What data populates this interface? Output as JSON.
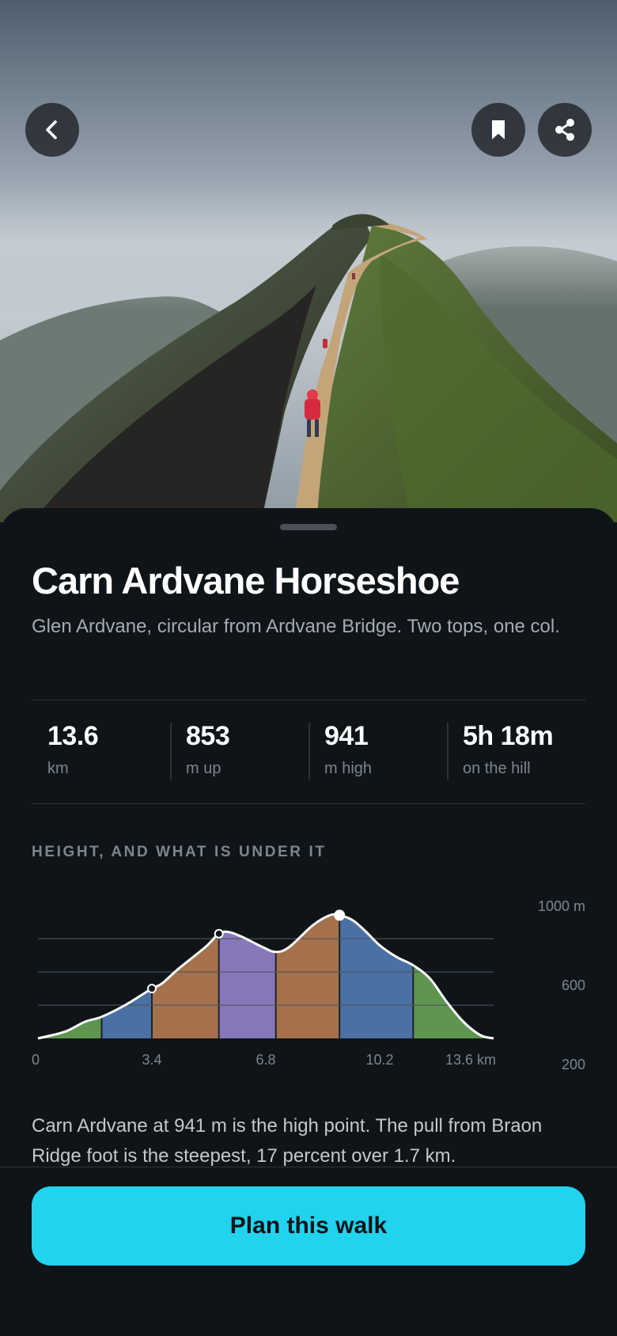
{
  "colors": {
    "accent": "#22d3ee",
    "background": "#0f1418",
    "terrain_green": "#5e9650",
    "terrain_blue": "#4b70a4",
    "terrain_brown": "#a4714c",
    "terrain_purple": "#8678b8"
  },
  "header": {
    "back_icon": "chevron-left-icon",
    "bookmark_icon": "bookmark-icon",
    "share_icon": "share-icon"
  },
  "route": {
    "title": "Carn Ardvane Horseshoe",
    "subtitle": "Glen Ardvane, circular from Ardvane Bridge. Two tops, one col."
  },
  "stats": [
    {
      "value": "13.6",
      "label": "km"
    },
    {
      "value": "853",
      "label": "m up"
    },
    {
      "value": "941",
      "label": "m high"
    },
    {
      "value": "5h 18m",
      "label": "on the hill"
    }
  ],
  "profile": {
    "section_label": "HEIGHT, AND WHAT IS UNDER IT",
    "note": "Carn Ardvane at 941 m is the high point. The pull from Braon Ridge foot is the steepest, 17 percent over 1.7 km."
  },
  "chart_data": {
    "type": "area",
    "xlabel": "",
    "ylabel": "",
    "x_ticks": [
      "0",
      "3.4",
      "6.8",
      "10.2",
      "13.6 km"
    ],
    "y_ticks": [
      "1000 m",
      "600",
      "200"
    ],
    "xlim": [
      0,
      13.6
    ],
    "ylim": [
      200,
      1000
    ],
    "grid": true,
    "x": [
      0,
      0.8,
      1.4,
      1.9,
      2.6,
      3.4,
      3.7,
      4.2,
      5.0,
      5.4,
      5.7,
      6.1,
      6.7,
      7.1,
      7.5,
      8.2,
      8.7,
      9.0,
      9.4,
      9.8,
      10.2,
      10.7,
      11.2,
      11.7,
      12.2,
      12.7,
      13.2,
      13.6
    ],
    "y": [
      200,
      240,
      300,
      330,
      400,
      500,
      530,
      620,
      750,
      830,
      840,
      810,
      750,
      720,
      750,
      880,
      940,
      941,
      910,
      840,
      760,
      690,
      640,
      560,
      420,
      300,
      220,
      200
    ],
    "markers": [
      {
        "x": 3.4,
        "y": 500
      },
      {
        "x": 5.4,
        "y": 830
      },
      {
        "x": 9.0,
        "y": 941
      }
    ],
    "segments": [
      {
        "from": 0,
        "to": 1.9,
        "color": "#5e9650"
      },
      {
        "from": 1.9,
        "to": 3.4,
        "color": "#4b70a4"
      },
      {
        "from": 3.4,
        "to": 5.4,
        "color": "#a4714c"
      },
      {
        "from": 5.4,
        "to": 7.1,
        "color": "#8678b8"
      },
      {
        "from": 7.1,
        "to": 9.0,
        "color": "#a4714c"
      },
      {
        "from": 9.0,
        "to": 11.2,
        "color": "#4b70a4"
      },
      {
        "from": 11.2,
        "to": 13.6,
        "color": "#5e9650"
      }
    ]
  },
  "cta": {
    "label": "Plan this walk"
  }
}
